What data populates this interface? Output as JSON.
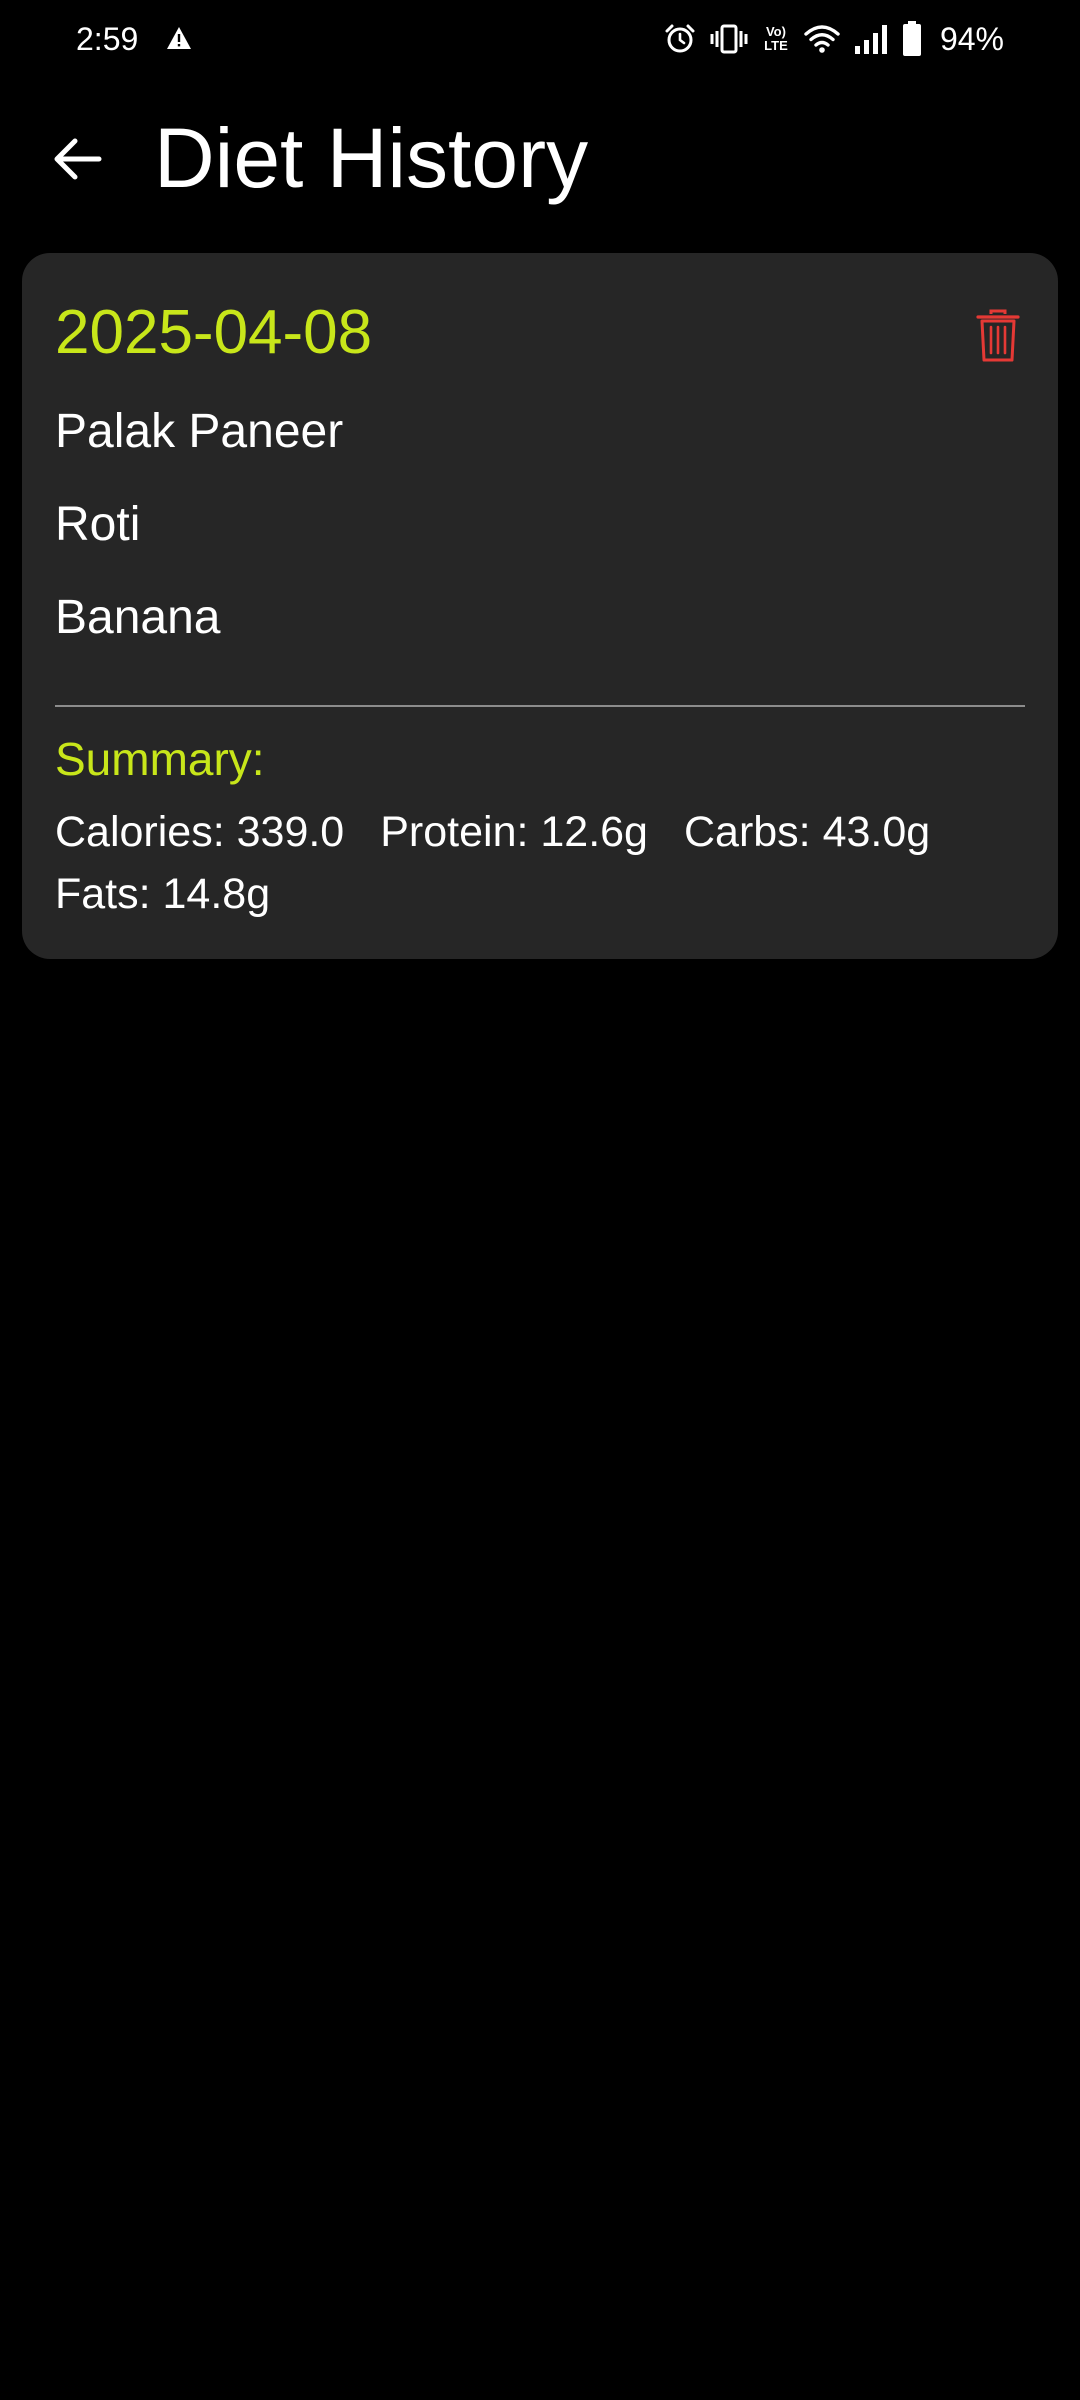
{
  "status_bar": {
    "time": "2:59",
    "battery_percent": "94%",
    "volte_label": "Vo) LTE",
    "icons": [
      "warning-icon",
      "alarm-icon",
      "vibrate-icon",
      "volte-icon",
      "wifi-icon",
      "signal-icon",
      "battery-icon"
    ]
  },
  "app_bar": {
    "title": "Diet History",
    "back_icon": "arrow-back-icon"
  },
  "history": {
    "entries": [
      {
        "date": "2025-04-08",
        "foods": [
          "Palak Paneer",
          "Roti",
          "Banana"
        ],
        "summary_label": "Summary:",
        "summary": {
          "calories": "Calories: 339.0",
          "protein": "Protein: 12.6g",
          "carbs": "Carbs: 43.0g",
          "fats": "Fats: 14.8g"
        },
        "delete_icon": "trash-icon"
      }
    ]
  },
  "colors": {
    "background": "#000000",
    "card": "#262626",
    "accent": "#c8e61a",
    "delete": "#e53935",
    "divider": "#8c8c8c",
    "text": "#ffffff"
  }
}
